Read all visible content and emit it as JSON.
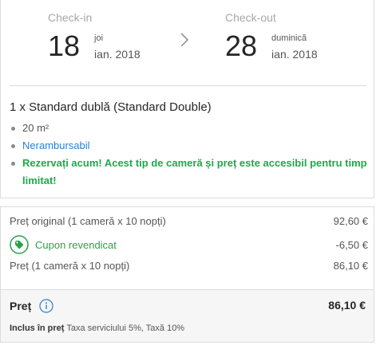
{
  "checkin": {
    "label": "Check-in",
    "day": "18",
    "weekday": "joi",
    "month_year": "ian. 2018"
  },
  "checkout": {
    "label": "Check-out",
    "day": "28",
    "weekday": "duminică",
    "month_year": "ian. 2018"
  },
  "room": {
    "title": "1 x Standard dublă (Standard Double)",
    "features": [
      "20 m²",
      "Nerambursabil",
      "Rezervați acum! Acest tip de cameră și preț este accesibil pentru timp limitat!"
    ]
  },
  "price": {
    "original_label": "Preț original (1 cameră x 10 nopți)",
    "original_value": "92,60 €",
    "coupon_label": "Cupon revendicat",
    "coupon_value": "-6,50 €",
    "net_label": "Preț (1 cameră x 10 nopți)",
    "net_value": "86,10 €",
    "total_label": "Preț",
    "total_value": "86,10 €",
    "included_strong": "Inclus în preț",
    "included_text": "Taxa serviciului 5%, Taxă 10%"
  },
  "icons": {
    "arrow": "chevron-right-icon",
    "coupon": "tag-icon",
    "info": "info-icon"
  },
  "colors": {
    "accent_blue": "#2c7fd5",
    "green": "#1ea94d"
  }
}
